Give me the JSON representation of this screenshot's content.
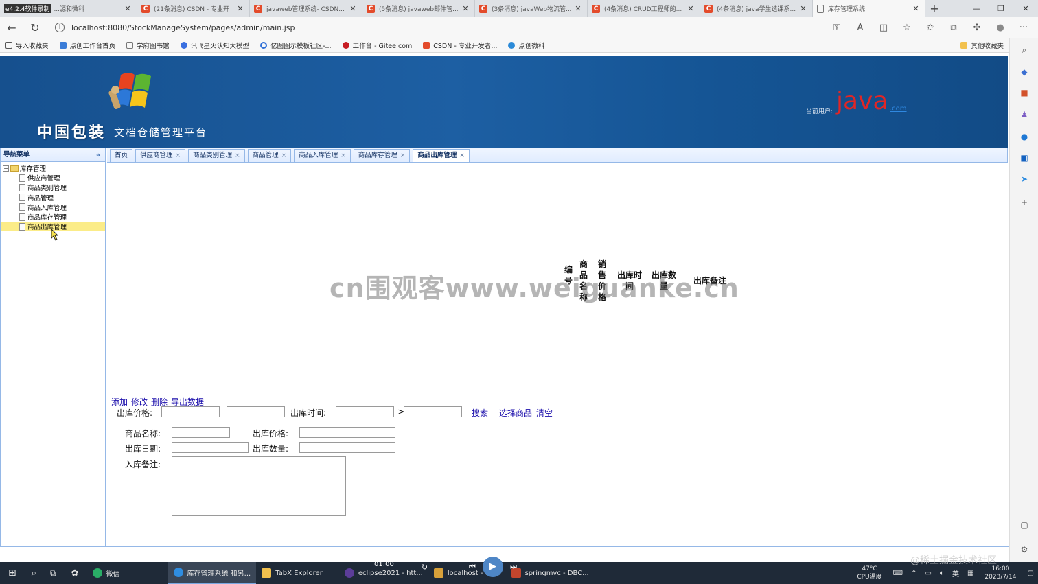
{
  "recorder_label": "e4.2.4软件录制",
  "browser": {
    "tabs": [
      {
        "title": "...源和微科",
        "favicon": "recorder-icon"
      },
      {
        "title": "(21条消息) CSDN - 专业开",
        "favicon": "csdn-icon"
      },
      {
        "title": "javaweb管理系统- CSDN...",
        "favicon": "csdn-icon"
      },
      {
        "title": "(5条消息) javaweb邮件管...",
        "favicon": "csdn-icon"
      },
      {
        "title": "(3条消息) javaWeb物流管...",
        "favicon": "csdn-icon"
      },
      {
        "title": "(4条消息) CRUD工程师的...",
        "favicon": "csdn-icon"
      },
      {
        "title": "(4条消息) java学生选课系...",
        "favicon": "csdn-icon"
      },
      {
        "title": "库存管理系统",
        "favicon": "page-icon"
      }
    ],
    "url": "localhost:8080/StockManageSystem/pages/admin/main.jsp",
    "bookmarks": [
      {
        "label": "导入收藏夹",
        "color": "#555555"
      },
      {
        "label": "点创工作台首页",
        "color": "#3b7dd8"
      },
      {
        "label": "学府图书馆",
        "color": "#777777"
      },
      {
        "label": "讯飞星火认知大模型",
        "color": "#3a6fe0"
      },
      {
        "label": "亿图图示模板社区-...",
        "color": "#2f6fd6"
      },
      {
        "label": "工作台 - Gitee.com",
        "color": "#c71d23"
      },
      {
        "label": "CSDN - 专业开发者...",
        "color": "#e34b2b"
      },
      {
        "label": "点创微科",
        "color": "#2b8ad8"
      }
    ],
    "other_bookmarks": "其他收藏夹"
  },
  "app": {
    "brand": "中国包装",
    "platform_title": "文档仓储管理平台",
    "current_user_label": "当前用户:",
    "user_name": "java",
    "user_suffix": ".com",
    "nav_title": "导航菜单",
    "tree_root": "库存管理",
    "tree_items": [
      "供应商管理",
      "商品类别管理",
      "商品管理",
      "商品入库管理",
      "商品库存管理",
      "商品出库管理"
    ],
    "selected_tree_item": "商品出库管理",
    "tabs": [
      "首页",
      "供应商管理",
      "商品类别管理",
      "商品管理",
      "商品入库管理",
      "商品库存管理",
      "商品出库管理"
    ],
    "active_tab": "商品出库管理"
  },
  "grid": {
    "headers": [
      "编号",
      "商品名称",
      "销售价格",
      "出库时间",
      "出库数量",
      "出库备注"
    ]
  },
  "toolbar": {
    "add": "添加",
    "edit": "修改",
    "delete": "删除",
    "export": "导出数据"
  },
  "search": {
    "price_label": "出库价格:",
    "range_sep1": "--",
    "time_label": "出库时间:",
    "range_sep2": "->",
    "search_link": "搜索",
    "choose_product_link": "选择商品",
    "clear_link": "清空"
  },
  "form": {
    "product_name_label": "商品名称:",
    "out_price_label": "出库价格:",
    "out_date_label": "出库日期:",
    "out_qty_label": "出库数量:",
    "remark_label": "入库备注:"
  },
  "watermark": "cn围观客www.weiguanke.cn",
  "taskbar": {
    "items": [
      "微信",
      "库存管理系统 和另...",
      "TabX Explorer",
      "eclipse2021 - htt...",
      "localhost - do...",
      "springmvc - DBC..."
    ],
    "media_time": "01:00",
    "temperature": "47°C",
    "temp_label": "CPU温度",
    "ime": "英",
    "time": "16:00",
    "date": "2023/7/14"
  },
  "credit": "@稀土掘金技术社区"
}
